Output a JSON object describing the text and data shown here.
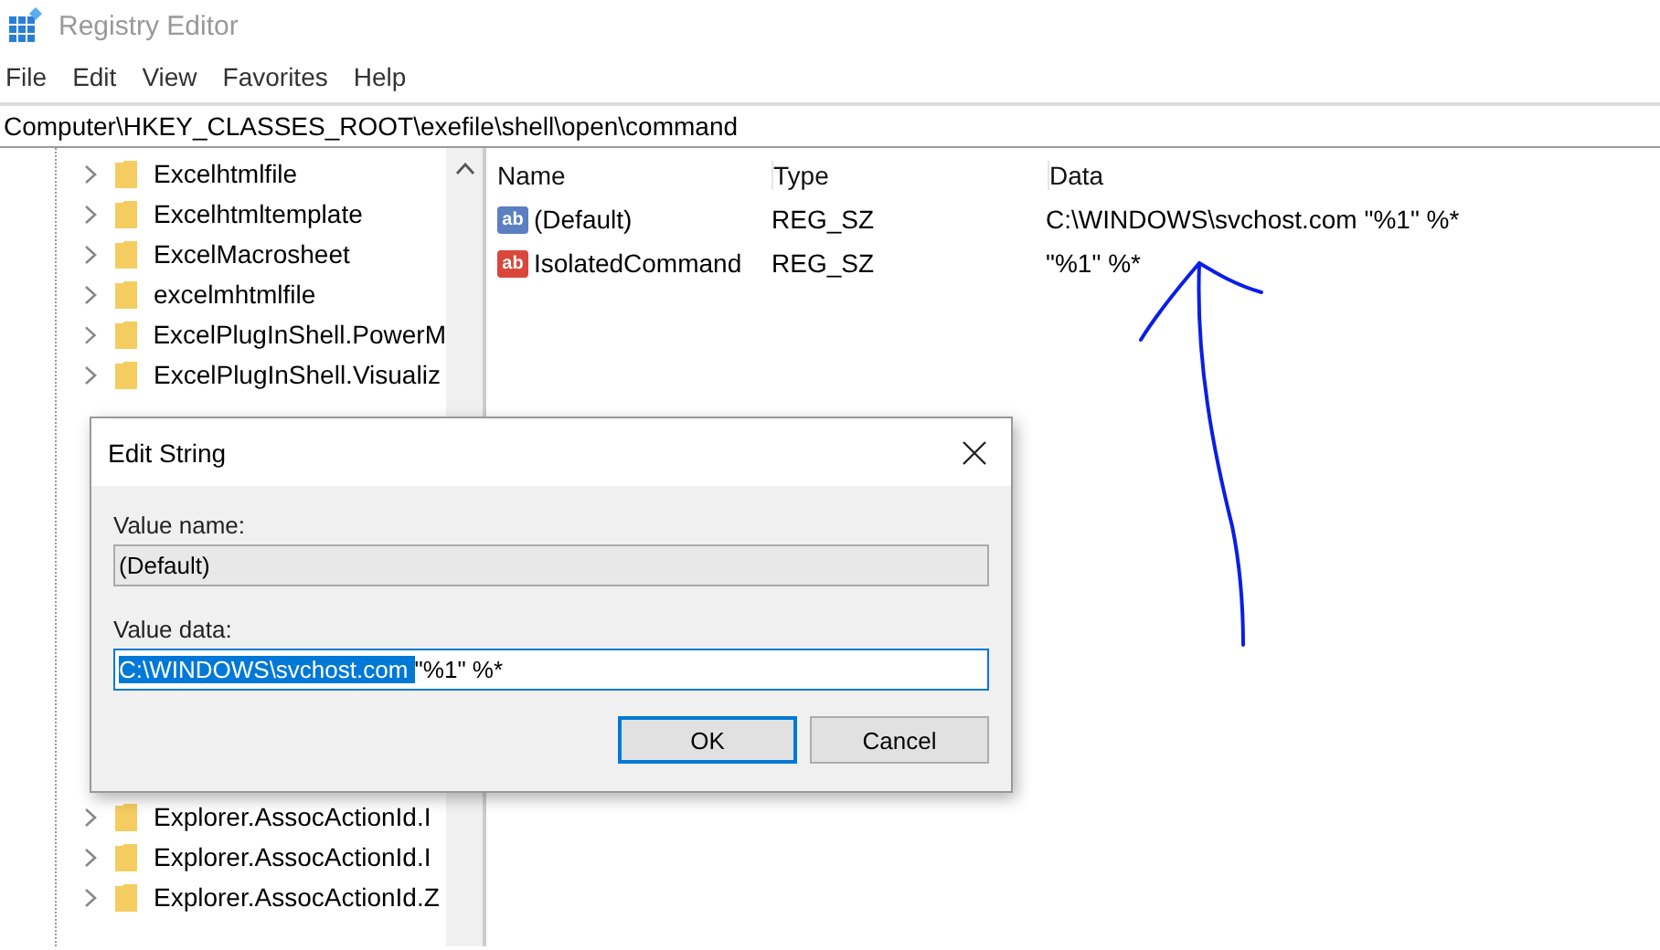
{
  "window": {
    "title": "Registry Editor"
  },
  "menu": [
    "File",
    "Edit",
    "View",
    "Favorites",
    "Help"
  ],
  "address": "Computer\\HKEY_CLASSES_ROOT\\exefile\\shell\\open\\command",
  "tree": {
    "items_above": [
      {
        "label": "Excelhtmlfile"
      },
      {
        "label": "Excelhtmltemplate"
      },
      {
        "label": "ExcelMacrosheet"
      },
      {
        "label": "excelmhtmlfile"
      },
      {
        "label": "ExcelPlugInShell.PowerM"
      },
      {
        "label": "ExcelPlugInShell.Visualiz"
      }
    ],
    "items_below": [
      {
        "label": "Explorer.AssocActionId.I"
      },
      {
        "label": "Explorer.AssocActionId.I"
      },
      {
        "label": "Explorer.AssocActionId.Z"
      }
    ]
  },
  "values": {
    "columns": [
      "Name",
      "Type",
      "Data"
    ],
    "rows": [
      {
        "icon": "ab",
        "color": "#5b7fc0",
        "name": "(Default)",
        "type": "REG_SZ",
        "data": "C:\\WINDOWS\\svchost.com \"%1\" %*"
      },
      {
        "icon": "ab",
        "color": "#d9473a",
        "name": "IsolatedCommand",
        "type": "REG_SZ",
        "data": "\"%1\" %*"
      }
    ]
  },
  "dialog": {
    "title": "Edit String",
    "value_name_label": "Value name:",
    "value_name": "(Default)",
    "value_data_label": "Value data:",
    "value_data_selected": "C:\\WINDOWS\\svchost.com ",
    "value_data_rest": "\"%1\" %*",
    "buttons": [
      {
        "label": "OK",
        "default": true
      },
      {
        "label": "Cancel",
        "default": false
      }
    ]
  }
}
